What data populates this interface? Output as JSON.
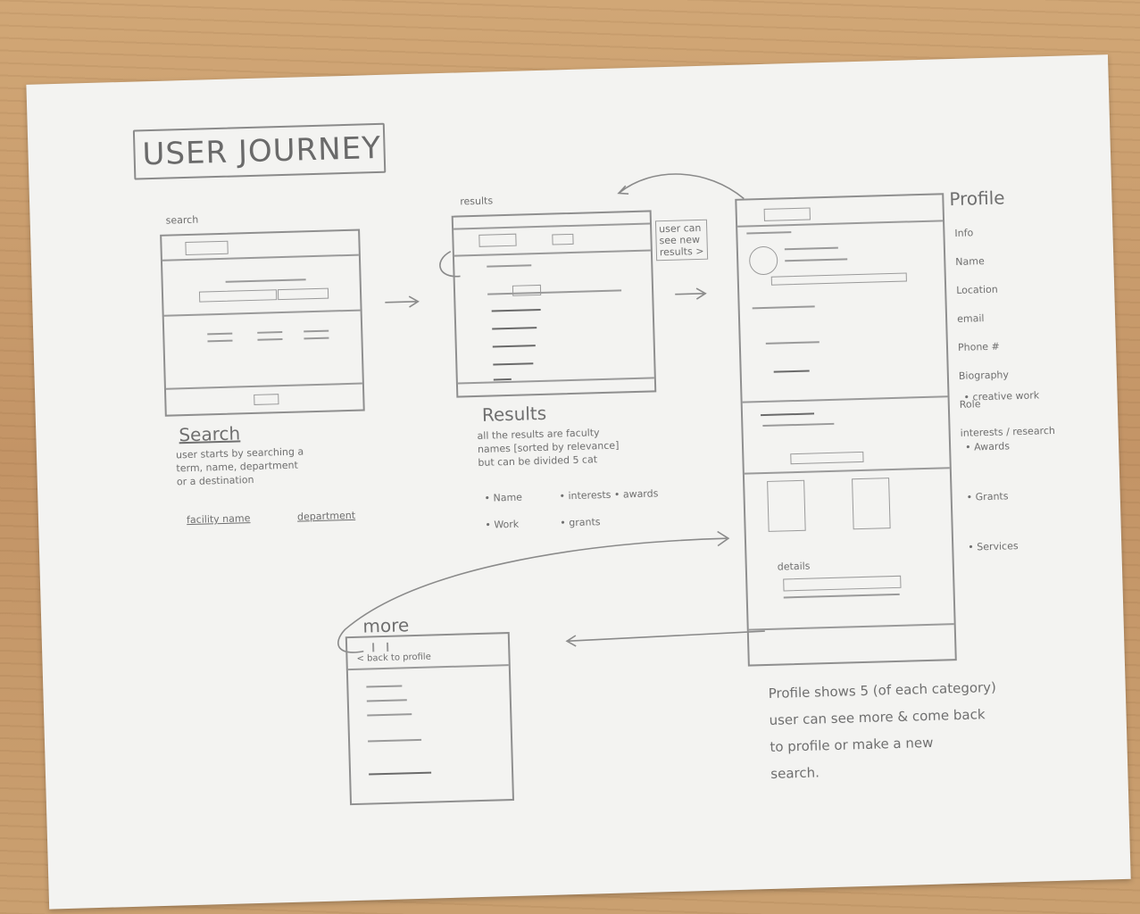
{
  "title": "USER JOURNEY",
  "search": {
    "frame_label": "search",
    "heading": "Search",
    "desc": "user starts by searching a\nterm, name, department\nor a destination",
    "flow_left": "facility name",
    "flow_right": "department"
  },
  "results": {
    "frame_label": "results",
    "heading": "Results",
    "desc": "all the results are faculty\nnames [sorted by relevance]\nbut can be divided 5 cat",
    "bullets_left": [
      "• Name",
      "• Work"
    ],
    "bullets_right": [
      "• interests  • awards",
      "• grants"
    ],
    "side_note": "user can\nsee new\nresults >"
  },
  "profile": {
    "heading": "Profile",
    "fields": [
      "Info",
      "Name",
      "Location",
      "email",
      "Phone #",
      "Biography",
      "Role",
      "interests / research"
    ],
    "bullets": [
      "• creative work",
      "• Awards",
      "• Grants",
      "• Services"
    ],
    "inner_label": "details",
    "note": "Profile shows 5 (of each category)\nuser can see more & come back\nto profile or make a new\nsearch."
  },
  "more": {
    "heading": "more",
    "back_link": "< back to profile"
  }
}
